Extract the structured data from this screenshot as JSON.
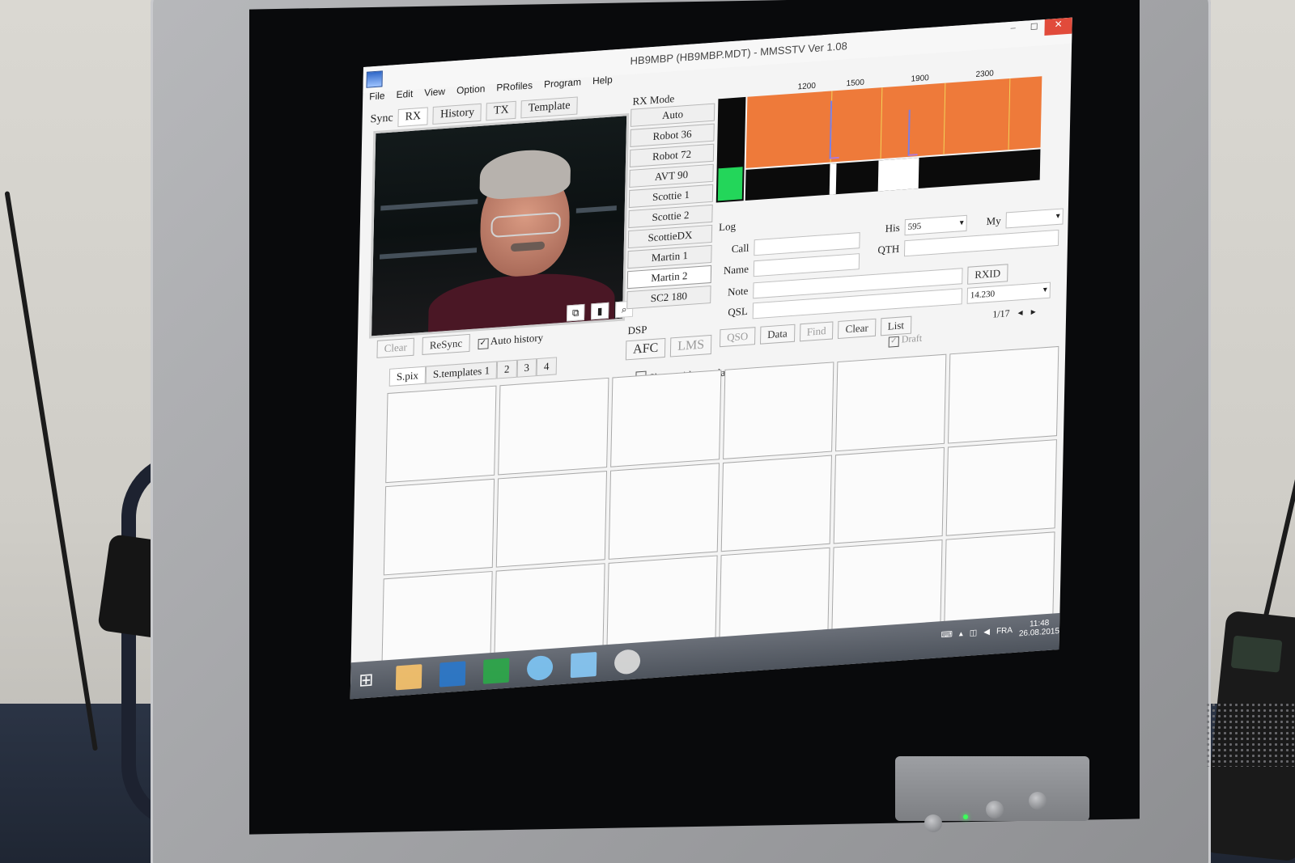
{
  "window": {
    "title": "HB9MBP (HB9MBP.MDT) - MMSSTV Ver 1.08",
    "controls": {
      "minimize": "–",
      "restore": "◻",
      "close": "✕"
    }
  },
  "menu": [
    "File",
    "Edit",
    "View",
    "Option",
    "PRofiles",
    "Program",
    "Help"
  ],
  "tabs": {
    "sync": "Sync",
    "rx": "RX",
    "history": "History",
    "tx": "TX",
    "template": "Template"
  },
  "rx_controls": {
    "clear": "Clear",
    "resync": "ReSync",
    "auto_history": "Auto history",
    "auto_history_checked": true
  },
  "thumbnail_tabs": [
    "S.pix",
    "S.templates 1",
    "2",
    "3",
    "4"
  ],
  "rx_mode": {
    "label": "RX Mode",
    "modes": [
      "Auto",
      "Robot 36",
      "Robot 72",
      "AVT 90",
      "Scottie 1",
      "Scottie 2",
      "ScottieDX",
      "Martin 1",
      "Martin 2",
      "SC2 180"
    ],
    "selected": "Martin 2"
  },
  "dsp": {
    "label": "DSP",
    "afc": "AFC",
    "lms": "LMS",
    "show_with_template": "Show with template"
  },
  "spectrum": {
    "ticks": [
      "1200",
      "1500",
      "1900",
      "2300"
    ],
    "colors": {
      "spectrum_bg": "#ee7a3a",
      "level_green": "#23d65a",
      "line_yellow": "#f2d35a"
    }
  },
  "log": {
    "label": "Log",
    "call_label": "Call",
    "name_label": "Name",
    "note_label": "Note",
    "qsl_label": "QSL",
    "his_label": "His",
    "his_value": "595",
    "my_label": "My",
    "my_value": "",
    "qth_label": "QTH",
    "rxid_button": "RXID",
    "frequency_value": "14.230",
    "qso_button": "QSO",
    "data_button": "Data",
    "find_button": "Find",
    "clear_button": "Clear",
    "list_button": "List",
    "draft_label": "Draft",
    "page_counter": "1/17"
  },
  "taskbar": {
    "language": "FRA",
    "time": "11:48",
    "date": "26.08.2015"
  }
}
